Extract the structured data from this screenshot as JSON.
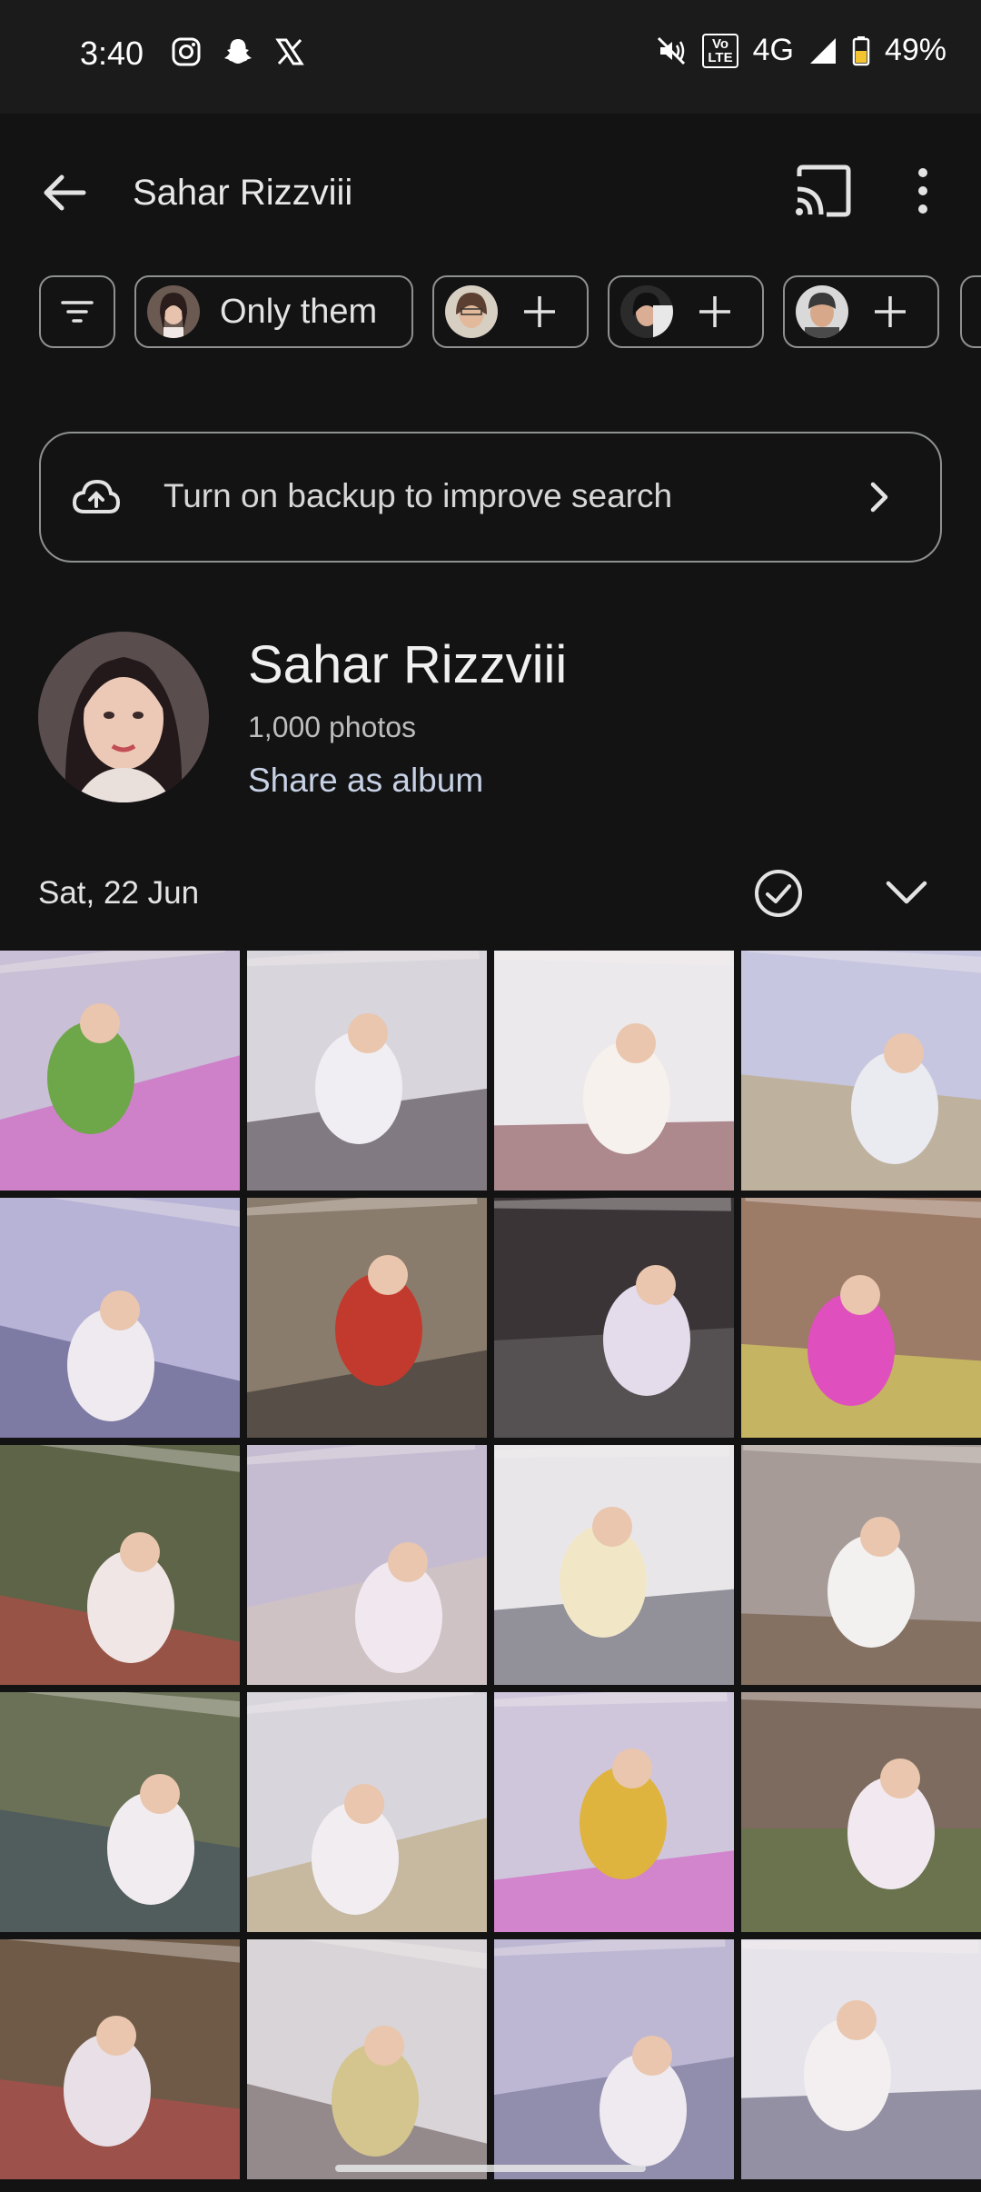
{
  "status_bar": {
    "time": "3:40",
    "network": "4G",
    "battery": "49%",
    "volte": "Vo\nLTE"
  },
  "app_bar": {
    "title": "Sahar Rizzviii"
  },
  "chips": {
    "only_them_label": "Only them"
  },
  "backup_banner": {
    "text": "Turn on backup to improve search"
  },
  "profile": {
    "name": "Sahar Rizzviii",
    "count": "1,000 photos",
    "share_label": "Share as album"
  },
  "section": {
    "date": "Sat, 22 Jun"
  },
  "photos": [
    {
      "bg": "#c9bfd6",
      "accent": "#6ea64a",
      "accent2": "#d14fbf"
    },
    {
      "bg": "#d8d5dc",
      "accent": "#f0eef2",
      "accent2": "#3c2f39"
    },
    {
      "bg": "#ece9ed",
      "accent": "#f6f1ec",
      "accent2": "#7a3a3f"
    },
    {
      "bg": "#c7c6e1",
      "accent": "#eaeaf1",
      "accent2": "#b7a36a"
    },
    {
      "bg": "#b7b3d6",
      "accent": "#efeaf0",
      "accent2": "#4e4a7c"
    },
    {
      "bg": "#8a7c6c",
      "accent": "#c23a2e",
      "accent2": "#2e2a2a"
    },
    {
      "bg": "#3a3437",
      "accent": "#e4dbeb",
      "accent2": "#6c6a6a"
    },
    {
      "bg": "#9c7b67",
      "accent": "#e04fbe",
      "accent2": "#e7e35d"
    },
    {
      "bg": "#5d6447",
      "accent": "#f0e6e6",
      "accent2": "#c74545"
    },
    {
      "bg": "#c6bcd2",
      "accent": "#f1e8ef",
      "accent2": "#d6c7b8"
    },
    {
      "bg": "#e9e6ea",
      "accent": "#f1e7c7",
      "accent2": "#4a4a58"
    },
    {
      "bg": "#a69b97",
      "accent": "#f2f1f0",
      "accent2": "#6a4e37"
    },
    {
      "bg": "#6a7156",
      "accent": "#f1ecf0",
      "accent2": "#3c4a63"
    },
    {
      "bg": "#d8d5dd",
      "accent": "#f2edf1",
      "accent2": "#b8a36c"
    },
    {
      "bg": "#cfc6dc",
      "accent": "#dfb43e",
      "accent2": "#d54fbf"
    },
    {
      "bg": "#7d6b5f",
      "accent": "#f1e9ef",
      "accent2": "#5b7a3f"
    },
    {
      "bg": "#6e5a47",
      "accent": "#e8e0e6",
      "accent2": "#c24d4e"
    },
    {
      "bg": "#d9d4d7",
      "accent": "#d4c58e",
      "accent2": "#5b4c4c"
    },
    {
      "bg": "#bdb7d4",
      "accent": "#efeaf0",
      "accent2": "#6b6b8c"
    },
    {
      "bg": "#e6e3ea",
      "accent": "#f3eff1",
      "accent2": "#4c4c66"
    }
  ]
}
